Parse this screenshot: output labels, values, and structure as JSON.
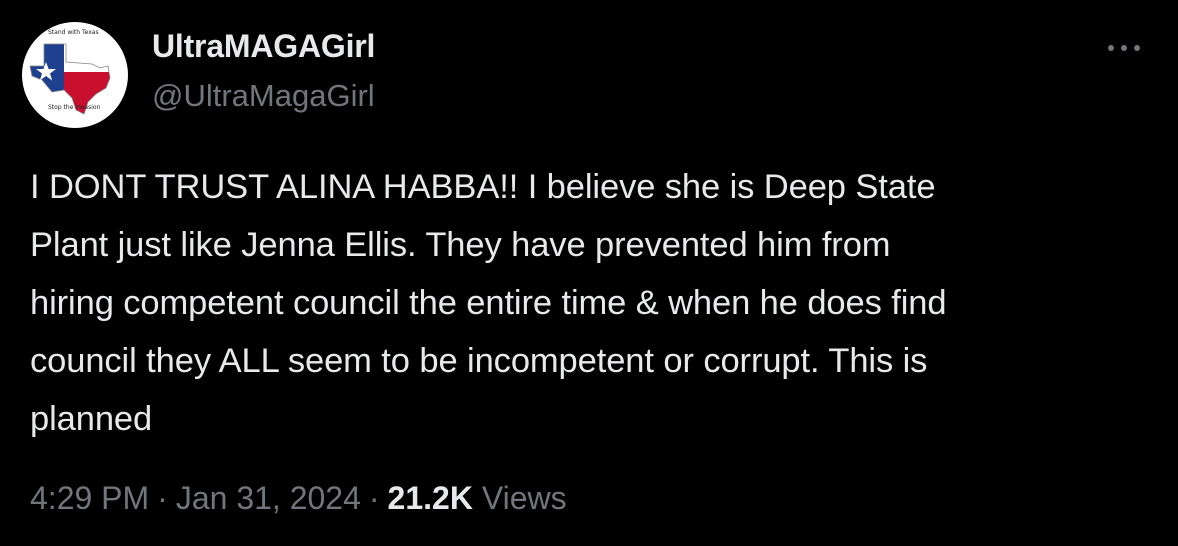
{
  "author": {
    "display_name": "UltraMAGAGirl",
    "handle": "@UltraMagaGirl",
    "avatar_top_text": "Stand with Texas",
    "avatar_bottom_text": "Stop the Invasion"
  },
  "tweet": {
    "text": "I DONT TRUST ALINA HABBA!! I believe she is Deep State\nPlant just like Jenna Ellis. They have prevented him from\nhiring competent council the entire time & when he does find\ncouncil they ALL seem to be incompetent or corrupt. This is\nplanned",
    "time": "4:29 PM",
    "separator": "·",
    "date": "Jan 31, 2024",
    "views_count": "21.2K",
    "views_label": "Views"
  },
  "icons": {
    "more": "more-horizontal-icon",
    "avatar_flag": "texas-flag-icon"
  },
  "colors": {
    "background": "#000000",
    "primary_text": "#e7e9ea",
    "secondary_text": "#71767b",
    "flag_blue": "#1f3f8f",
    "flag_red": "#c8102e"
  }
}
